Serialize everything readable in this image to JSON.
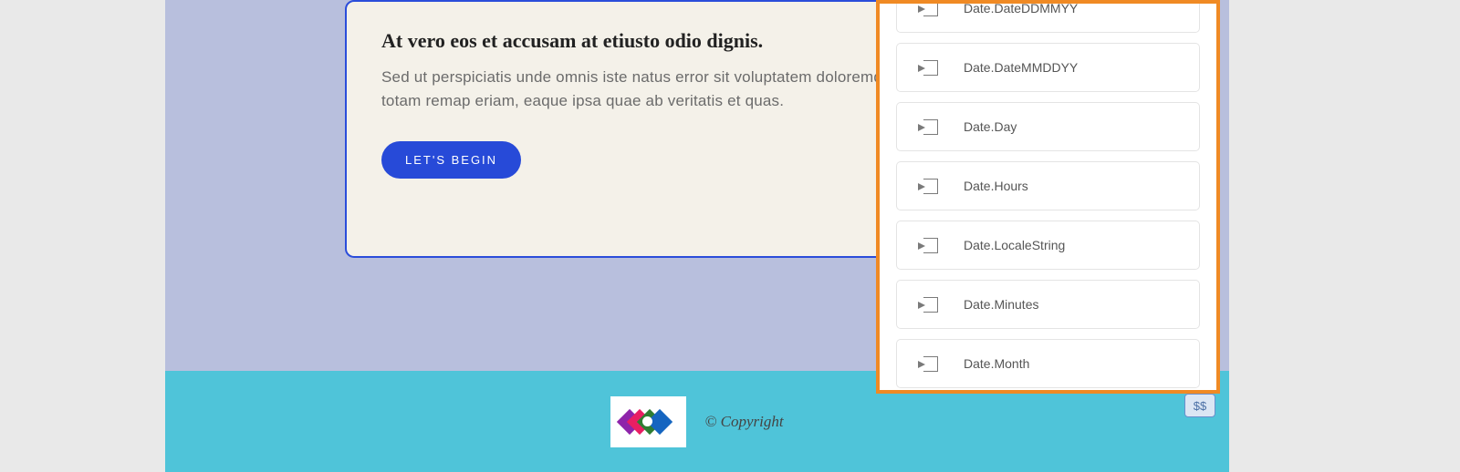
{
  "card": {
    "subtitle": "At vero eos et accusam at etiusto odio dignis.",
    "body": "Sed ut perspiciatis unde omnis iste natus error sit voluptatem doloremque laudantium totam remap eriam, eaque ipsa quae ab veritatis et quas.",
    "button": "LET'S BEGIN"
  },
  "footer": {
    "copyright": "© Copyright",
    "badge": "$$"
  },
  "panel": {
    "items": [
      {
        "label": "Date.DateDDMMYY"
      },
      {
        "label": "Date.DateMMDDYY"
      },
      {
        "label": "Date.Day"
      },
      {
        "label": "Date.Hours"
      },
      {
        "label": "Date.LocaleString"
      },
      {
        "label": "Date.Minutes"
      },
      {
        "label": "Date.Month"
      }
    ]
  }
}
